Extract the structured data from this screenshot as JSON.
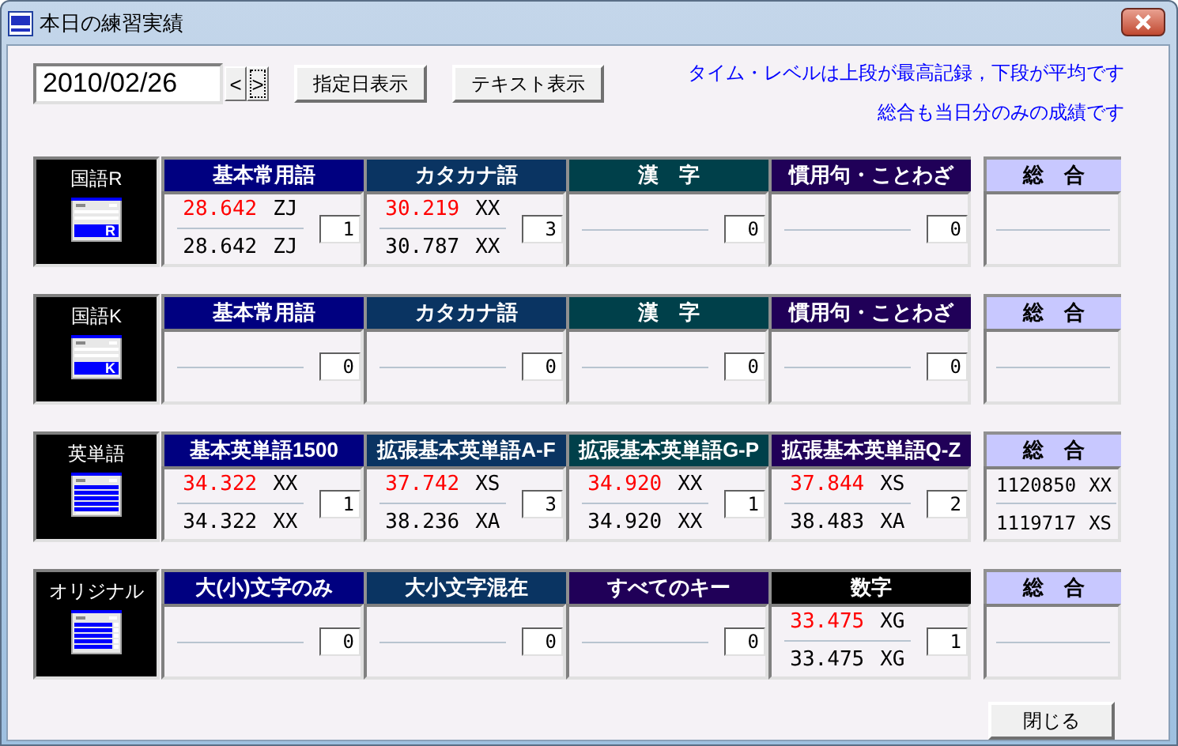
{
  "window": {
    "title": "本日の練習実績"
  },
  "date_field": {
    "value": "2010/02/26"
  },
  "nav_buttons": [
    {
      "label": "<",
      "focused": false
    },
    {
      "label": ">",
      "focused": true
    }
  ],
  "buttons": [
    "指定日表示",
    "テキスト表示"
  ],
  "notes": [
    "タイム・レベルは上段が最高記録，下段が平均です",
    "総合も当日分のみの成績です"
  ],
  "sections": [
    {
      "label": "国語R",
      "icon": {
        "kind": "letter",
        "letter": "R"
      },
      "categories": [
        {
          "title": "基本常用語",
          "color": "#000080",
          "best": {
            "score": "28.642",
            "rank": "ZJ"
          },
          "average": {
            "score": "28.642",
            "rank": "ZJ"
          },
          "count": "1"
        },
        {
          "title": "カタカナ語",
          "color": "#0a3462",
          "best": {
            "score": "30.219",
            "rank": "XX"
          },
          "average": {
            "score": "30.787",
            "rank": "XX"
          },
          "count": "3"
        },
        {
          "title": "漢　字",
          "color": "#00404a",
          "count": "0"
        },
        {
          "title": "慣用句・ことわざ",
          "color": "#200058",
          "count": "0"
        }
      ],
      "total": {
        "title": "総　合"
      }
    },
    {
      "label": "国語K",
      "icon": {
        "kind": "letter",
        "letter": "K"
      },
      "categories": [
        {
          "title": "基本常用語",
          "color": "#000080",
          "count": "0"
        },
        {
          "title": "カタカナ語",
          "color": "#0a3462",
          "count": "0"
        },
        {
          "title": "漢　字",
          "color": "#00404a",
          "count": "0"
        },
        {
          "title": "慣用句・ことわざ",
          "color": "#200058",
          "count": "0"
        }
      ],
      "total": {
        "title": "総　合"
      }
    },
    {
      "label": "英単語",
      "icon": {
        "kind": "lines"
      },
      "categories": [
        {
          "title": "基本英単語1500",
          "color": "#000080",
          "best": {
            "score": "34.322",
            "rank": "XX"
          },
          "average": {
            "score": "34.322",
            "rank": "XX"
          },
          "count": "1"
        },
        {
          "title": "拡張基本英単語A-F",
          "color": "#0a3462",
          "best": {
            "score": "37.742",
            "rank": "XS"
          },
          "average": {
            "score": "38.236",
            "rank": "XA"
          },
          "count": "3"
        },
        {
          "title": "拡張基本英単語G-P",
          "color": "#00404a",
          "best": {
            "score": "34.920",
            "rank": "XX"
          },
          "average": {
            "score": "34.920",
            "rank": "XX"
          },
          "count": "1"
        },
        {
          "title": "拡張基本英単語Q-Z",
          "color": "#200058",
          "best": {
            "score": "37.844",
            "rank": "XS"
          },
          "average": {
            "score": "38.483",
            "rank": "XA"
          },
          "count": "2"
        }
      ],
      "total": {
        "title": "総　合",
        "best": {
          "score": "1120850",
          "rank": "XX"
        },
        "average": {
          "score": "1119717",
          "rank": "XS"
        }
      }
    },
    {
      "label": "オリジナル",
      "icon": {
        "kind": "small-lines"
      },
      "categories": [
        {
          "title": "大(小)文字のみ",
          "color": "#000080",
          "count": "0"
        },
        {
          "title": "大小文字混在",
          "color": "#0a3462",
          "count": "0"
        },
        {
          "title": "すべてのキー",
          "color": "#200058",
          "count": "0"
        },
        {
          "title": "数字",
          "color": "#000000",
          "best": {
            "score": "33.475",
            "rank": "XG"
          },
          "average": {
            "score": "33.475",
            "rank": "XG"
          },
          "count": "1"
        }
      ],
      "total": {
        "title": "総　合"
      }
    }
  ],
  "close_button": "閉じる"
}
